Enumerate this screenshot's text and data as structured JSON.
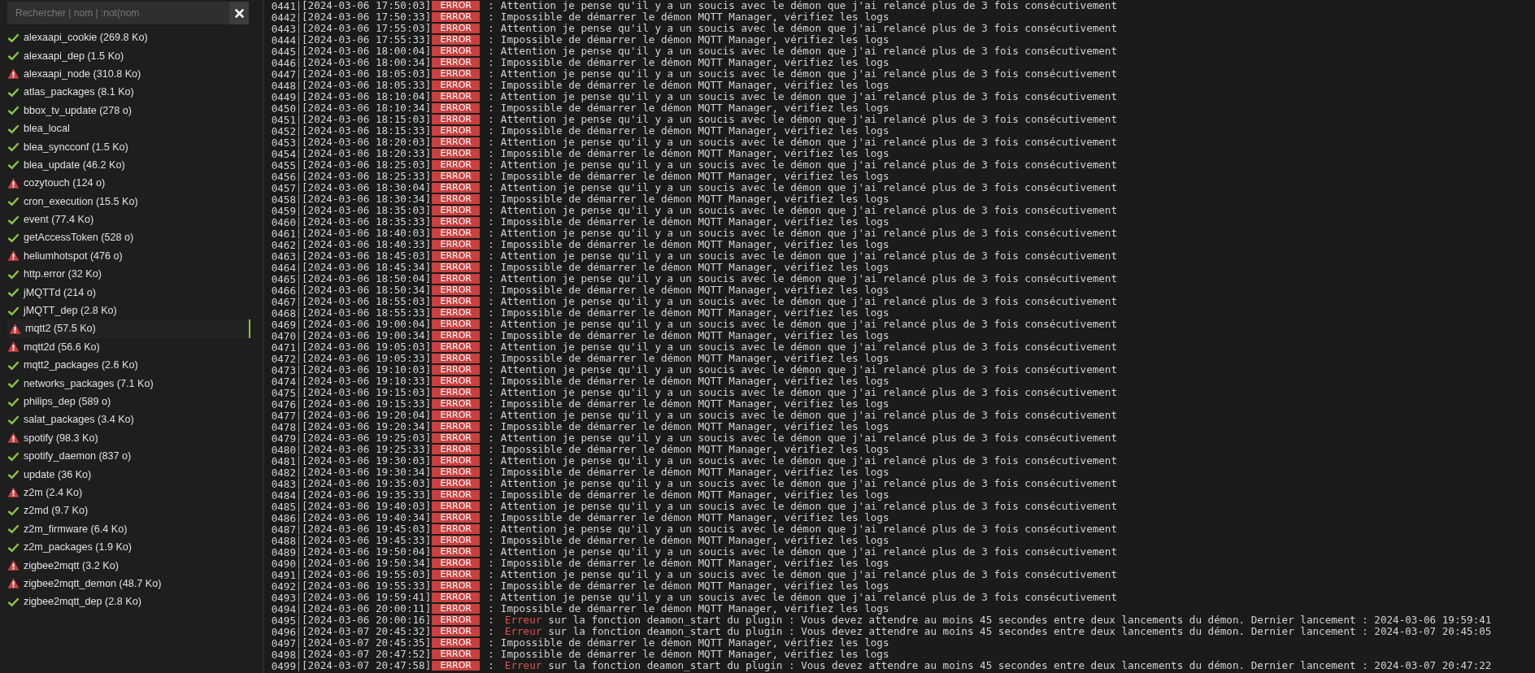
{
  "sidebar": {
    "search": {
      "placeholder": "Rechercher | nom | :not(nom"
    },
    "items": [
      {
        "label": "alexaapi_cookie (269.8 Ko)",
        "kind": "ok",
        "selected": false
      },
      {
        "label": "alexaapi_dep (1.5 Ko)",
        "kind": "ok",
        "selected": false
      },
      {
        "label": "alexaapi_node (310.8 Ko)",
        "kind": "error",
        "selected": false
      },
      {
        "label": "atlas_packages (8.1 Ko)",
        "kind": "ok",
        "selected": false
      },
      {
        "label": "bbox_tv_update (278 o)",
        "kind": "ok",
        "selected": false
      },
      {
        "label": "blea_local",
        "kind": "ok",
        "selected": false
      },
      {
        "label": "blea_syncconf (1.5 Ko)",
        "kind": "ok",
        "selected": false
      },
      {
        "label": "blea_update (46.2 Ko)",
        "kind": "ok",
        "selected": false
      },
      {
        "label": "cozytouch (124 o)",
        "kind": "error",
        "selected": false
      },
      {
        "label": "cron_execution (15.5 Ko)",
        "kind": "ok",
        "selected": false
      },
      {
        "label": "event (77.4 Ko)",
        "kind": "ok",
        "selected": false
      },
      {
        "label": "getAccessToken (528 o)",
        "kind": "ok",
        "selected": false
      },
      {
        "label": "heliumhotspot (476 o)",
        "kind": "error",
        "selected": false
      },
      {
        "label": "http.error (32 Ko)",
        "kind": "ok",
        "selected": false
      },
      {
        "label": "jMQTTd (214 o)",
        "kind": "ok",
        "selected": false
      },
      {
        "label": "jMQTT_dep (2.8 Ko)",
        "kind": "ok",
        "selected": false
      },
      {
        "label": "mqtt2 (57.5 Ko)",
        "kind": "error",
        "selected": true
      },
      {
        "label": "mqtt2d (56.6 Ko)",
        "kind": "error",
        "selected": false
      },
      {
        "label": "mqtt2_packages (2.6 Ko)",
        "kind": "ok",
        "selected": false
      },
      {
        "label": "networks_packages (7.1 Ko)",
        "kind": "ok",
        "selected": false
      },
      {
        "label": "philips_dep (589 o)",
        "kind": "ok",
        "selected": false
      },
      {
        "label": "salat_packages (3.4 Ko)",
        "kind": "ok",
        "selected": false
      },
      {
        "label": "spotify (98.3 Ko)",
        "kind": "error",
        "selected": false
      },
      {
        "label": "spotify_daemon (837 o)",
        "kind": "ok",
        "selected": false
      },
      {
        "label": "update (36 Ko)",
        "kind": "ok",
        "selected": false
      },
      {
        "label": "z2m (2.4 Ko)",
        "kind": "error",
        "selected": false
      },
      {
        "label": "z2md (9.7 Ko)",
        "kind": "ok",
        "selected": false
      },
      {
        "label": "z2m_firmware (6.4 Ko)",
        "kind": "ok",
        "selected": false
      },
      {
        "label": "z2m_packages (1.9 Ko)",
        "kind": "ok",
        "selected": false
      },
      {
        "label": "zigbee2mqtt (3.2 Ko)",
        "kind": "error",
        "selected": false
      },
      {
        "label": "zigbee2mqtt_demon (48.7 Ko)",
        "kind": "error",
        "selected": false
      },
      {
        "label": "zigbee2mqtt_dep (2.8 Ko)",
        "kind": "ok",
        "selected": false
      }
    ]
  },
  "log": {
    "rows": [
      {
        "n": "0441",
        "time": "[2024-03-06 17:50:03]",
        "level": "ERROR",
        "sep": ":",
        "message": "Attention je pense qu'il y a un soucis avec le démon que j'ai relancé plus de 3 fois consécutivement"
      },
      {
        "n": "0442",
        "time": "[2024-03-06 17:50:33]",
        "level": "ERROR",
        "sep": ":",
        "message": "Impossible de démarrer le démon MQTT Manager, vérifiez les logs"
      },
      {
        "n": "0443",
        "time": "[2024-03-06 17:55:03]",
        "level": "ERROR",
        "sep": ":",
        "message": "Attention je pense qu'il y a un soucis avec le démon que j'ai relancé plus de 3 fois consécutivement"
      },
      {
        "n": "0444",
        "time": "[2024-03-06 17:55:33]",
        "level": "ERROR",
        "sep": ":",
        "message": "Impossible de démarrer le démon MQTT Manager, vérifiez les logs"
      },
      {
        "n": "0445",
        "time": "[2024-03-06 18:00:04]",
        "level": "ERROR",
        "sep": ":",
        "message": "Attention je pense qu'il y a un soucis avec le démon que j'ai relancé plus de 3 fois consécutivement"
      },
      {
        "n": "0446",
        "time": "[2024-03-06 18:00:34]",
        "level": "ERROR",
        "sep": ":",
        "message": "Impossible de démarrer le démon MQTT Manager, vérifiez les logs"
      },
      {
        "n": "0447",
        "time": "[2024-03-06 18:05:03]",
        "level": "ERROR",
        "sep": ":",
        "message": "Attention je pense qu'il y a un soucis avec le démon que j'ai relancé plus de 3 fois consécutivement"
      },
      {
        "n": "0448",
        "time": "[2024-03-06 18:05:33]",
        "level": "ERROR",
        "sep": ":",
        "message": "Impossible de démarrer le démon MQTT Manager, vérifiez les logs"
      },
      {
        "n": "0449",
        "time": "[2024-03-06 18:10:04]",
        "level": "ERROR",
        "sep": ":",
        "message": "Attention je pense qu'il y a un soucis avec le démon que j'ai relancé plus de 3 fois consécutivement"
      },
      {
        "n": "0450",
        "time": "[2024-03-06 18:10:34]",
        "level": "ERROR",
        "sep": ":",
        "message": "Impossible de démarrer le démon MQTT Manager, vérifiez les logs"
      },
      {
        "n": "0451",
        "time": "[2024-03-06 18:15:03]",
        "level": "ERROR",
        "sep": ":",
        "message": "Attention je pense qu'il y a un soucis avec le démon que j'ai relancé plus de 3 fois consécutivement"
      },
      {
        "n": "0452",
        "time": "[2024-03-06 18:15:33]",
        "level": "ERROR",
        "sep": ":",
        "message": "Impossible de démarrer le démon MQTT Manager, vérifiez les logs"
      },
      {
        "n": "0453",
        "time": "[2024-03-06 18:20:03]",
        "level": "ERROR",
        "sep": ":",
        "message": "Attention je pense qu'il y a un soucis avec le démon que j'ai relancé plus de 3 fois consécutivement"
      },
      {
        "n": "0454",
        "time": "[2024-03-06 18:20:33]",
        "level": "ERROR",
        "sep": ":",
        "message": "Impossible de démarrer le démon MQTT Manager, vérifiez les logs"
      },
      {
        "n": "0455",
        "time": "[2024-03-06 18:25:03]",
        "level": "ERROR",
        "sep": ":",
        "message": "Attention je pense qu'il y a un soucis avec le démon que j'ai relancé plus de 3 fois consécutivement"
      },
      {
        "n": "0456",
        "time": "[2024-03-06 18:25:33]",
        "level": "ERROR",
        "sep": ":",
        "message": "Impossible de démarrer le démon MQTT Manager, vérifiez les logs"
      },
      {
        "n": "0457",
        "time": "[2024-03-06 18:30:04]",
        "level": "ERROR",
        "sep": ":",
        "message": "Attention je pense qu'il y a un soucis avec le démon que j'ai relancé plus de 3 fois consécutivement"
      },
      {
        "n": "0458",
        "time": "[2024-03-06 18:30:34]",
        "level": "ERROR",
        "sep": ":",
        "message": "Impossible de démarrer le démon MQTT Manager, vérifiez les logs"
      },
      {
        "n": "0459",
        "time": "[2024-03-06 18:35:03]",
        "level": "ERROR",
        "sep": ":",
        "message": "Attention je pense qu'il y a un soucis avec le démon que j'ai relancé plus de 3 fois consécutivement"
      },
      {
        "n": "0460",
        "time": "[2024-03-06 18:35:33]",
        "level": "ERROR",
        "sep": ":",
        "message": "Impossible de démarrer le démon MQTT Manager, vérifiez les logs"
      },
      {
        "n": "0461",
        "time": "[2024-03-06 18:40:03]",
        "level": "ERROR",
        "sep": ":",
        "message": "Attention je pense qu'il y a un soucis avec le démon que j'ai relancé plus de 3 fois consécutivement"
      },
      {
        "n": "0462",
        "time": "[2024-03-06 18:40:33]",
        "level": "ERROR",
        "sep": ":",
        "message": "Impossible de démarrer le démon MQTT Manager, vérifiez les logs"
      },
      {
        "n": "0463",
        "time": "[2024-03-06 18:45:03]",
        "level": "ERROR",
        "sep": ":",
        "message": "Attention je pense qu'il y a un soucis avec le démon que j'ai relancé plus de 3 fois consécutivement"
      },
      {
        "n": "0464",
        "time": "[2024-03-06 18:45:34]",
        "level": "ERROR",
        "sep": ":",
        "message": "Impossible de démarrer le démon MQTT Manager, vérifiez les logs"
      },
      {
        "n": "0465",
        "time": "[2024-03-06 18:50:04]",
        "level": "ERROR",
        "sep": ":",
        "message": "Attention je pense qu'il y a un soucis avec le démon que j'ai relancé plus de 3 fois consécutivement"
      },
      {
        "n": "0466",
        "time": "[2024-03-06 18:50:34]",
        "level": "ERROR",
        "sep": ":",
        "message": "Impossible de démarrer le démon MQTT Manager, vérifiez les logs"
      },
      {
        "n": "0467",
        "time": "[2024-03-06 18:55:03]",
        "level": "ERROR",
        "sep": ":",
        "message": "Attention je pense qu'il y a un soucis avec le démon que j'ai relancé plus de 3 fois consécutivement"
      },
      {
        "n": "0468",
        "time": "[2024-03-06 18:55:33]",
        "level": "ERROR",
        "sep": ":",
        "message": "Impossible de démarrer le démon MQTT Manager, vérifiez les logs"
      },
      {
        "n": "0469",
        "time": "[2024-03-06 19:00:04]",
        "level": "ERROR",
        "sep": ":",
        "message": "Attention je pense qu'il y a un soucis avec le démon que j'ai relancé plus de 3 fois consécutivement"
      },
      {
        "n": "0470",
        "time": "[2024-03-06 19:00:34]",
        "level": "ERROR",
        "sep": ":",
        "message": "Impossible de démarrer le démon MQTT Manager, vérifiez les logs"
      },
      {
        "n": "0471",
        "time": "[2024-03-06 19:05:03]",
        "level": "ERROR",
        "sep": ":",
        "message": "Attention je pense qu'il y a un soucis avec le démon que j'ai relancé plus de 3 fois consécutivement"
      },
      {
        "n": "0472",
        "time": "[2024-03-06 19:05:33]",
        "level": "ERROR",
        "sep": ":",
        "message": "Impossible de démarrer le démon MQTT Manager, vérifiez les logs"
      },
      {
        "n": "0473",
        "time": "[2024-03-06 19:10:03]",
        "level": "ERROR",
        "sep": ":",
        "message": "Attention je pense qu'il y a un soucis avec le démon que j'ai relancé plus de 3 fois consécutivement"
      },
      {
        "n": "0474",
        "time": "[2024-03-06 19:10:33]",
        "level": "ERROR",
        "sep": ":",
        "message": "Impossible de démarrer le démon MQTT Manager, vérifiez les logs"
      },
      {
        "n": "0475",
        "time": "[2024-03-06 19:15:03]",
        "level": "ERROR",
        "sep": ":",
        "message": "Attention je pense qu'il y a un soucis avec le démon que j'ai relancé plus de 3 fois consécutivement"
      },
      {
        "n": "0476",
        "time": "[2024-03-06 19:15:33]",
        "level": "ERROR",
        "sep": ":",
        "message": "Impossible de démarrer le démon MQTT Manager, vérifiez les logs"
      },
      {
        "n": "0477",
        "time": "[2024-03-06 19:20:04]",
        "level": "ERROR",
        "sep": ":",
        "message": "Attention je pense qu'il y a un soucis avec le démon que j'ai relancé plus de 3 fois consécutivement"
      },
      {
        "n": "0478",
        "time": "[2024-03-06 19:20:34]",
        "level": "ERROR",
        "sep": ":",
        "message": "Impossible de démarrer le démon MQTT Manager, vérifiez les logs"
      },
      {
        "n": "0479",
        "time": "[2024-03-06 19:25:03]",
        "level": "ERROR",
        "sep": ":",
        "message": "Attention je pense qu'il y a un soucis avec le démon que j'ai relancé plus de 3 fois consécutivement"
      },
      {
        "n": "0480",
        "time": "[2024-03-06 19:25:33]",
        "level": "ERROR",
        "sep": ":",
        "message": "Impossible de démarrer le démon MQTT Manager, vérifiez les logs"
      },
      {
        "n": "0481",
        "time": "[2024-03-06 19:30:03]",
        "level": "ERROR",
        "sep": ":",
        "message": "Attention je pense qu'il y a un soucis avec le démon que j'ai relancé plus de 3 fois consécutivement"
      },
      {
        "n": "0482",
        "time": "[2024-03-06 19:30:34]",
        "level": "ERROR",
        "sep": ":",
        "message": "Impossible de démarrer le démon MQTT Manager, vérifiez les logs"
      },
      {
        "n": "0483",
        "time": "[2024-03-06 19:35:03]",
        "level": "ERROR",
        "sep": ":",
        "message": "Attention je pense qu'il y a un soucis avec le démon que j'ai relancé plus de 3 fois consécutivement"
      },
      {
        "n": "0484",
        "time": "[2024-03-06 19:35:33]",
        "level": "ERROR",
        "sep": ":",
        "message": "Impossible de démarrer le démon MQTT Manager, vérifiez les logs"
      },
      {
        "n": "0485",
        "time": "[2024-03-06 19:40:03]",
        "level": "ERROR",
        "sep": ":",
        "message": "Attention je pense qu'il y a un soucis avec le démon que j'ai relancé plus de 3 fois consécutivement"
      },
      {
        "n": "0486",
        "time": "[2024-03-06 19:40:34]",
        "level": "ERROR",
        "sep": ":",
        "message": "Impossible de démarrer le démon MQTT Manager, vérifiez les logs"
      },
      {
        "n": "0487",
        "time": "[2024-03-06 19:45:03]",
        "level": "ERROR",
        "sep": ":",
        "message": "Attention je pense qu'il y a un soucis avec le démon que j'ai relancé plus de 3 fois consécutivement"
      },
      {
        "n": "0488",
        "time": "[2024-03-06 19:45:33]",
        "level": "ERROR",
        "sep": ":",
        "message": "Impossible de démarrer le démon MQTT Manager, vérifiez les logs"
      },
      {
        "n": "0489",
        "time": "[2024-03-06 19:50:04]",
        "level": "ERROR",
        "sep": ":",
        "message": "Attention je pense qu'il y a un soucis avec le démon que j'ai relancé plus de 3 fois consécutivement"
      },
      {
        "n": "0490",
        "time": "[2024-03-06 19:50:34]",
        "level": "ERROR",
        "sep": ":",
        "message": "Impossible de démarrer le démon MQTT Manager, vérifiez les logs"
      },
      {
        "n": "0491",
        "time": "[2024-03-06 19:55:03]",
        "level": "ERROR",
        "sep": ":",
        "message": "Attention je pense qu'il y a un soucis avec le démon que j'ai relancé plus de 3 fois consécutivement"
      },
      {
        "n": "0492",
        "time": "[2024-03-06 19:55:33]",
        "level": "ERROR",
        "sep": ":",
        "message": "Impossible de démarrer le démon MQTT Manager, vérifiez les logs"
      },
      {
        "n": "0493",
        "time": "[2024-03-06 19:59:41]",
        "level": "ERROR",
        "sep": ":",
        "message": "Attention je pense qu'il y a un soucis avec le démon que j'ai relancé plus de 3 fois consécutivement"
      },
      {
        "n": "0494",
        "time": "[2024-03-06 20:00:11]",
        "level": "ERROR",
        "sep": ":",
        "message": "Impossible de démarrer le démon MQTT Manager, vérifiez les logs"
      },
      {
        "n": "0495",
        "time": "[2024-03-06 20:00:16]",
        "level": "ERROR",
        "sep": ":",
        "keyword": "Erreur",
        "message": "sur la fonction deamon_start du plugin : Vous devez attendre au moins 45 secondes entre deux lancements du démon. Dernier lancement : 2024-03-06 19:59:41"
      },
      {
        "n": "0496",
        "time": "[2024-03-07 20:45:32]",
        "level": "ERROR",
        "sep": ":",
        "keyword": "Erreur",
        "message": "sur la fonction deamon_start du plugin : Vous devez attendre au moins 45 secondes entre deux lancements du démon. Dernier lancement : 2024-03-07 20:45:05"
      },
      {
        "n": "0497",
        "time": "[2024-03-07 20:45:35]",
        "level": "ERROR",
        "sep": ":",
        "message": "Impossible de démarrer le démon MQTT Manager, vérifiez les logs"
      },
      {
        "n": "0498",
        "time": "[2024-03-07 20:47:52]",
        "level": "ERROR",
        "sep": ":",
        "message": "Impossible de démarrer le démon MQTT Manager, vérifiez les logs"
      },
      {
        "n": "0499",
        "time": "[2024-03-07 20:47:58]",
        "level": "ERROR",
        "sep": ":",
        "keyword": "Erreur",
        "message": "sur la fonction deamon_start du plugin : Vous devez attendre au moins 45 secondes entre deux lancements du démon. Dernier lancement : 2024-03-07 20:47:22"
      }
    ]
  }
}
